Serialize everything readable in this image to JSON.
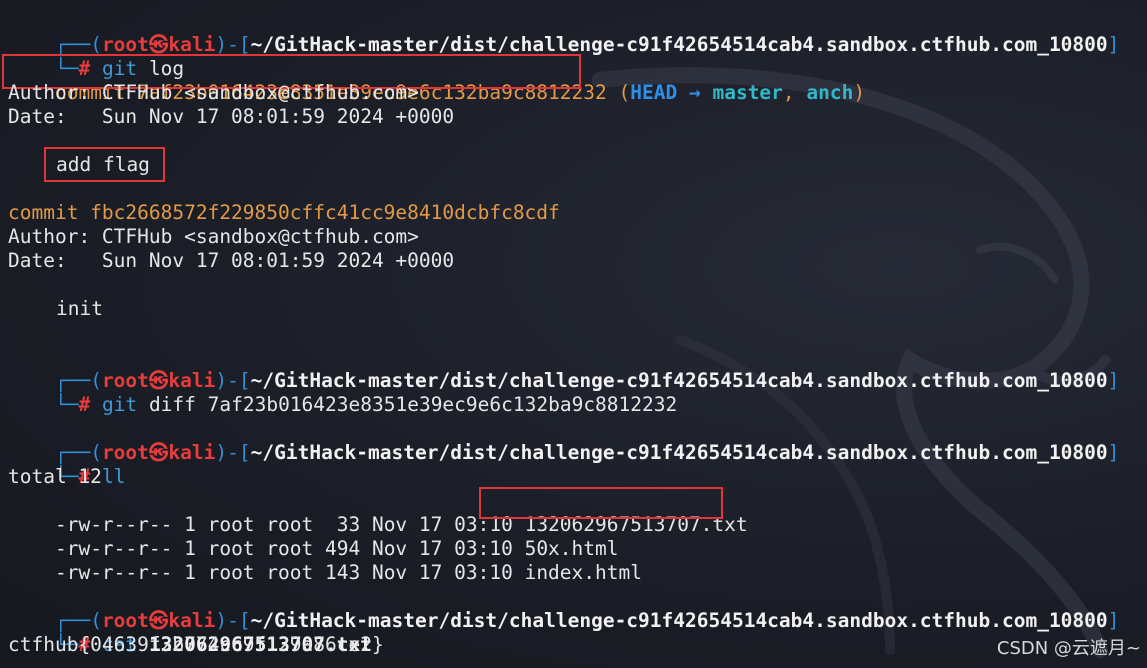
{
  "prompt": {
    "open": "┌──(",
    "user": "root",
    "skull": "㉿",
    "host": "kali",
    "mid": ")-[",
    "path": "~/GitHack-master/dist/challenge-c91f42654514cab4.sandbox.ctfhub.com_10800",
    "close": "]",
    "corner": "└─",
    "hash": "#"
  },
  "block1": {
    "cmd": "git",
    "args": "log",
    "commit1_hash_line": "commit 7af23b016423e8351e39ec9e6c132ba9c8812232",
    "refs_open": "(",
    "refs_head": "HEAD",
    "refs_arrow": "→",
    "refs_master": "master",
    "refs_sep": ",",
    "refs_anch": "anch",
    "refs_close": ")",
    "author1": "Author: CTFHub <sandbox@ctfhub.com>",
    "date1": "Date:   Sun Nov 17 08:01:59 2024 +0000",
    "msg1": "add flag",
    "commit2_hash_line": "commit fbc2668572f229850cffc41cc9e8410dcbfc8cdf",
    "author2": "Author: CTFHub <sandbox@ctfhub.com>",
    "date2": "Date:   Sun Nov 17 08:01:59 2024 +0000",
    "msg2": "init"
  },
  "block2": {
    "cmd": "git",
    "args": "diff 7af23b016423e8351e39ec9e6c132ba9c8812232"
  },
  "block3": {
    "cmd": "ll",
    "total": "total 12",
    "files": [
      {
        "meta": "-rw-r--r-- 1 root root  33 Nov 17 03:10 ",
        "name": "132062967513707.txt"
      },
      {
        "meta": "-rw-r--r-- 1 root root 494 Nov 17 03:10 ",
        "name": "50x.html"
      },
      {
        "meta": "-rw-r--r-- 1 root root 143 Nov 17 03:10 ",
        "name": "index.html"
      }
    ]
  },
  "block4": {
    "cmd": "cat",
    "args": "132062967513707.txt",
    "output": "ctfhub{04639f2b774cc9f129a86ce2}"
  },
  "watermark": "CSDN @云遮月~",
  "colors": {
    "background": "#1a1d26",
    "prompt_frame": "#2f8fd9",
    "user_host": "#e83c3c",
    "commit_hash": "#e29a46",
    "branch": "#2fb8c8",
    "head": "#2e8fe8",
    "highlight_box": "#e0363a"
  }
}
